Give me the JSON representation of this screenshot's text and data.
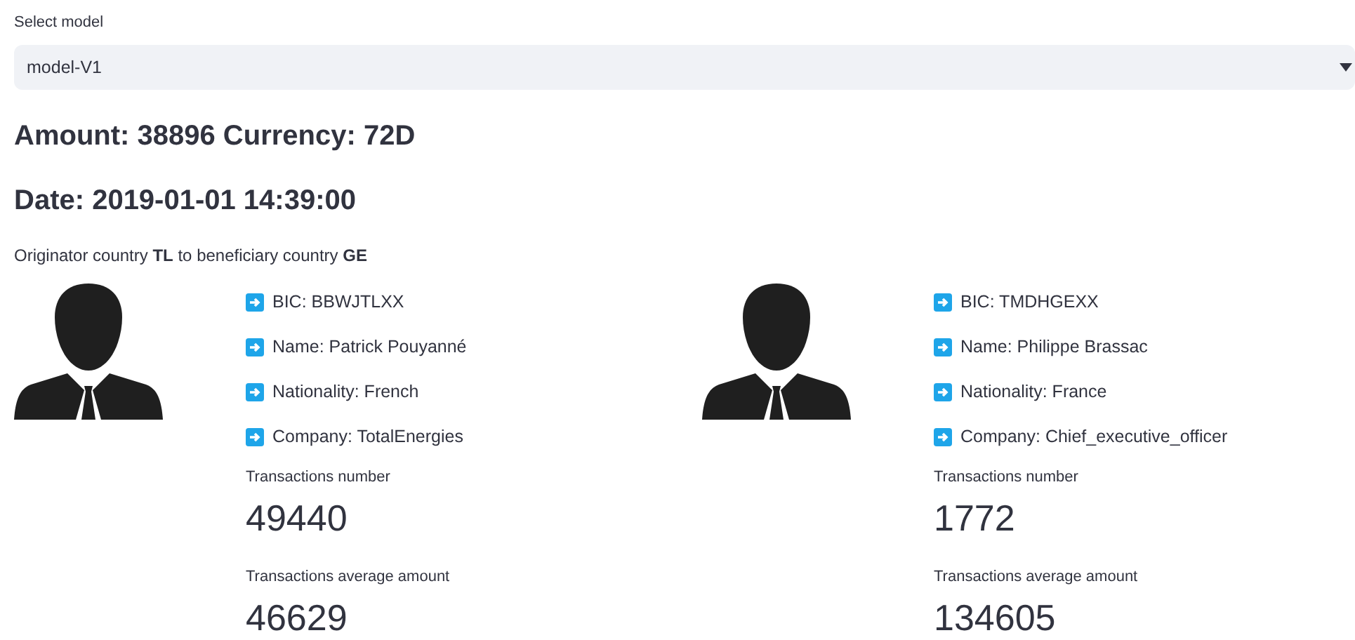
{
  "select": {
    "label": "Select model",
    "value": "model-V1"
  },
  "headings": [
    "Amount: 38896 Currency: 72D",
    "Date: 2019-01-01 14:39:00"
  ],
  "route": "Originator country **TL** to beneficiary country **GE**",
  "parties": [
    {
      "details": [
        "BIC: BBWJTLXX",
        "Name: Patrick Pouyanné",
        "Nationality: French",
        "Company: TotalEnergies"
      ],
      "metrics": [
        {
          "label": "Transactions number",
          "value": "49440"
        },
        {
          "label": "Transactions average amount",
          "value": "46629"
        }
      ]
    },
    {
      "details": [
        "BIC: TMDHGEXX",
        "Name: Philippe Brassac",
        "Nationality: France",
        "Company: Chief_executive_officer"
      ],
      "metrics": [
        {
          "label": "Transactions number",
          "value": "1772"
        },
        {
          "label": "Transactions average amount",
          "value": "134605"
        }
      ]
    }
  ]
}
